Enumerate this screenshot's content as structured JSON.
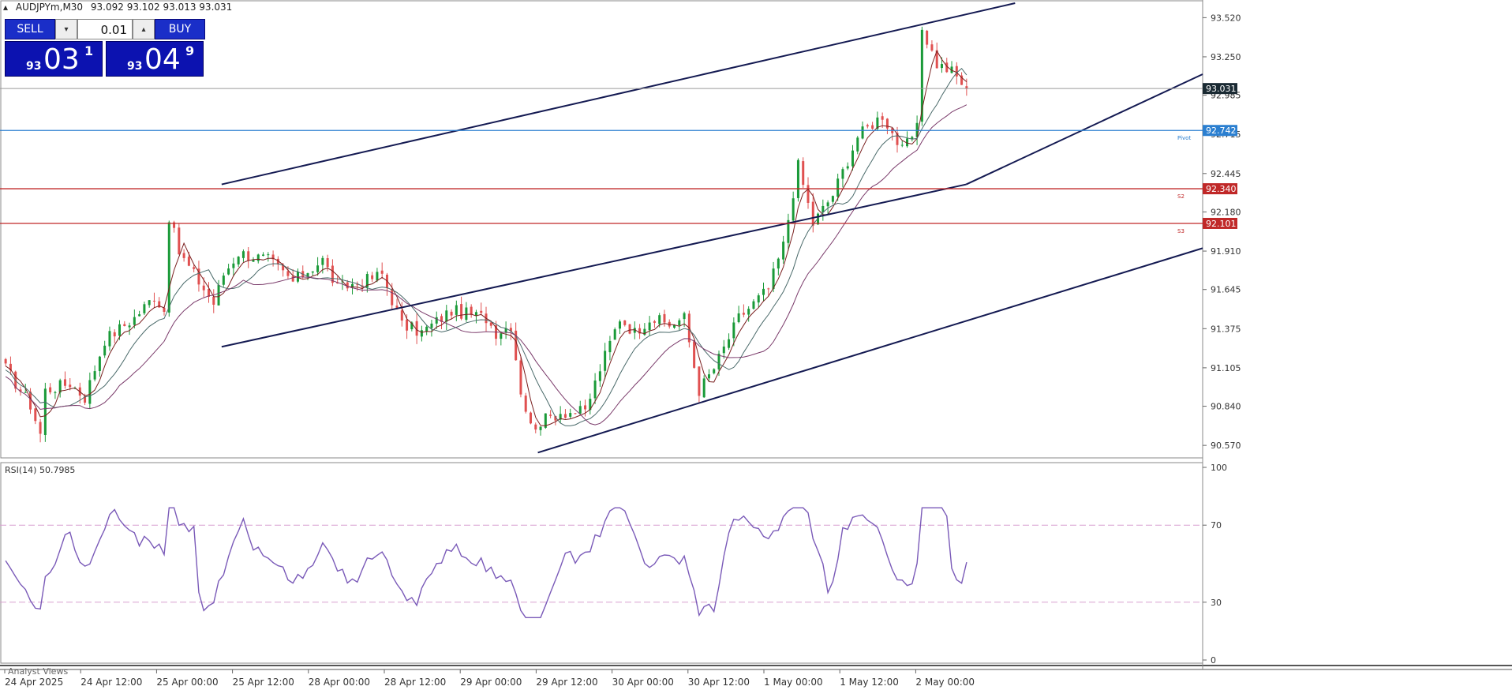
{
  "header": {
    "symbol": "AUDJPYm,M30",
    "ohlc": "93.092 93.102 93.013 93.031",
    "indicator_label": "RSI(14) 50.7985",
    "bottom_panel": "Analyst Views"
  },
  "trade_panel": {
    "sell_label": "SELL",
    "buy_label": "BUY",
    "lot": "0.01",
    "sell_prefix": "93",
    "sell_big": "03",
    "sell_sup": "1",
    "buy_prefix": "93",
    "buy_big": "04",
    "buy_sup": "9"
  },
  "colors": {
    "bull": "#1a9a38",
    "bear": "#e05050",
    "grid": "#d8d8d8",
    "channel": "#141a52",
    "pivot": "#2b7fd0",
    "support": "#c02828",
    "current": "#9a9a9a",
    "rsi": "#7a5ab8",
    "rsi_level": "#d8a0d0"
  },
  "chart_data": {
    "type": "candlestick",
    "price_axis_ticks": [
      "93.520",
      "93.250",
      "92.985",
      "92.715",
      "92.445",
      "92.180",
      "91.910",
      "91.645",
      "91.375",
      "91.105",
      "90.840",
      "90.570"
    ],
    "price_range": [
      90.5,
      93.62
    ],
    "time_labels": [
      "24 Apr 2025",
      "24 Apr 12:00",
      "25 Apr 00:00",
      "25 Apr 12:00",
      "28 Apr 00:00",
      "28 Apr 12:00",
      "29 Apr 00:00",
      "29 Apr 12:00",
      "30 Apr 00:00",
      "30 Apr 12:00",
      "1 May 00:00",
      "1 May 12:00",
      "2 May 00:00"
    ],
    "candle_count": 195,
    "price_anchors": [
      [
        0,
        91.1
      ],
      [
        8,
        90.85
      ],
      [
        12,
        90.65
      ],
      [
        14,
        90.95
      ],
      [
        22,
        91.0
      ],
      [
        28,
        90.9
      ],
      [
        34,
        91.3
      ],
      [
        45,
        91.45
      ],
      [
        52,
        91.6
      ],
      [
        56,
        91.5
      ],
      [
        58,
        92.15
      ],
      [
        61,
        91.9
      ],
      [
        66,
        91.75
      ],
      [
        72,
        91.55
      ],
      [
        76,
        91.75
      ],
      [
        82,
        91.9
      ],
      [
        92,
        91.85
      ],
      [
        100,
        91.7
      ],
      [
        110,
        91.85
      ],
      [
        116,
        91.65
      ],
      [
        124,
        91.7
      ],
      [
        132,
        91.75
      ],
      [
        138,
        91.4
      ],
      [
        146,
        91.35
      ],
      [
        156,
        91.5
      ],
      [
        168,
        91.45
      ],
      [
        172,
        91.35
      ],
      [
        176,
        91.4
      ],
      [
        180,
        90.95
      ],
      [
        184,
        90.7
      ],
      [
        194,
        90.8
      ],
      [
        202,
        90.8
      ],
      [
        208,
        91.1
      ],
      [
        214,
        91.45
      ],
      [
        220,
        91.35
      ],
      [
        226,
        91.45
      ],
      [
        232,
        91.4
      ],
      [
        238,
        91.45
      ],
      [
        242,
        90.95
      ],
      [
        248,
        91.1
      ],
      [
        256,
        91.45
      ],
      [
        266,
        91.65
      ],
      [
        272,
        91.95
      ],
      [
        277,
        92.5
      ],
      [
        282,
        92.1
      ],
      [
        290,
        92.3
      ],
      [
        298,
        92.7
      ],
      [
        306,
        92.85
      ],
      [
        314,
        92.6
      ],
      [
        318,
        92.75
      ],
      [
        320,
        93.45
      ],
      [
        326,
        93.2
      ],
      [
        330,
        93.15
      ],
      [
        336,
        93.03
      ]
    ],
    "last_price": 93.031,
    "levels": [
      {
        "label": "92.742",
        "value": 92.742,
        "name": "Pivot",
        "color": "#2b7fd0"
      },
      {
        "label": "92.340",
        "value": 92.34,
        "name": "S2",
        "color": "#c02828"
      },
      {
        "label": "92.101",
        "value": 92.101,
        "name": "S3",
        "color": "#c02828"
      }
    ],
    "current_label": "93.031",
    "trend_channel": {
      "upper": [
        {
          "c": 76,
          "p": 92.37
        },
        {
          "c": 352,
          "p": 93.62
        }
      ],
      "middle_left": [
        {
          "c": 76,
          "p": 91.25
        },
        {
          "c": 335,
          "p": 92.37
        }
      ],
      "middle_right": [
        {
          "c": 335,
          "p": 92.37
        },
        {
          "c": 506,
          "p": 93.13
        }
      ],
      "lower": [
        {
          "c": 186,
          "p": 90.52
        },
        {
          "c": 506,
          "p": 91.93
        }
      ]
    },
    "moving_averages": [
      {
        "period": 20,
        "color": "#7a1f1f"
      },
      {
        "period": 50,
        "color": "#4a6a6a"
      },
      {
        "period": 100,
        "color": "#7a3a6a"
      }
    ],
    "rsi": {
      "label": "RSI(14) 50.7985",
      "ticks": [
        "100",
        "70",
        "30",
        "0"
      ],
      "levels": [
        70,
        30
      ],
      "last": 50.7985
    }
  }
}
